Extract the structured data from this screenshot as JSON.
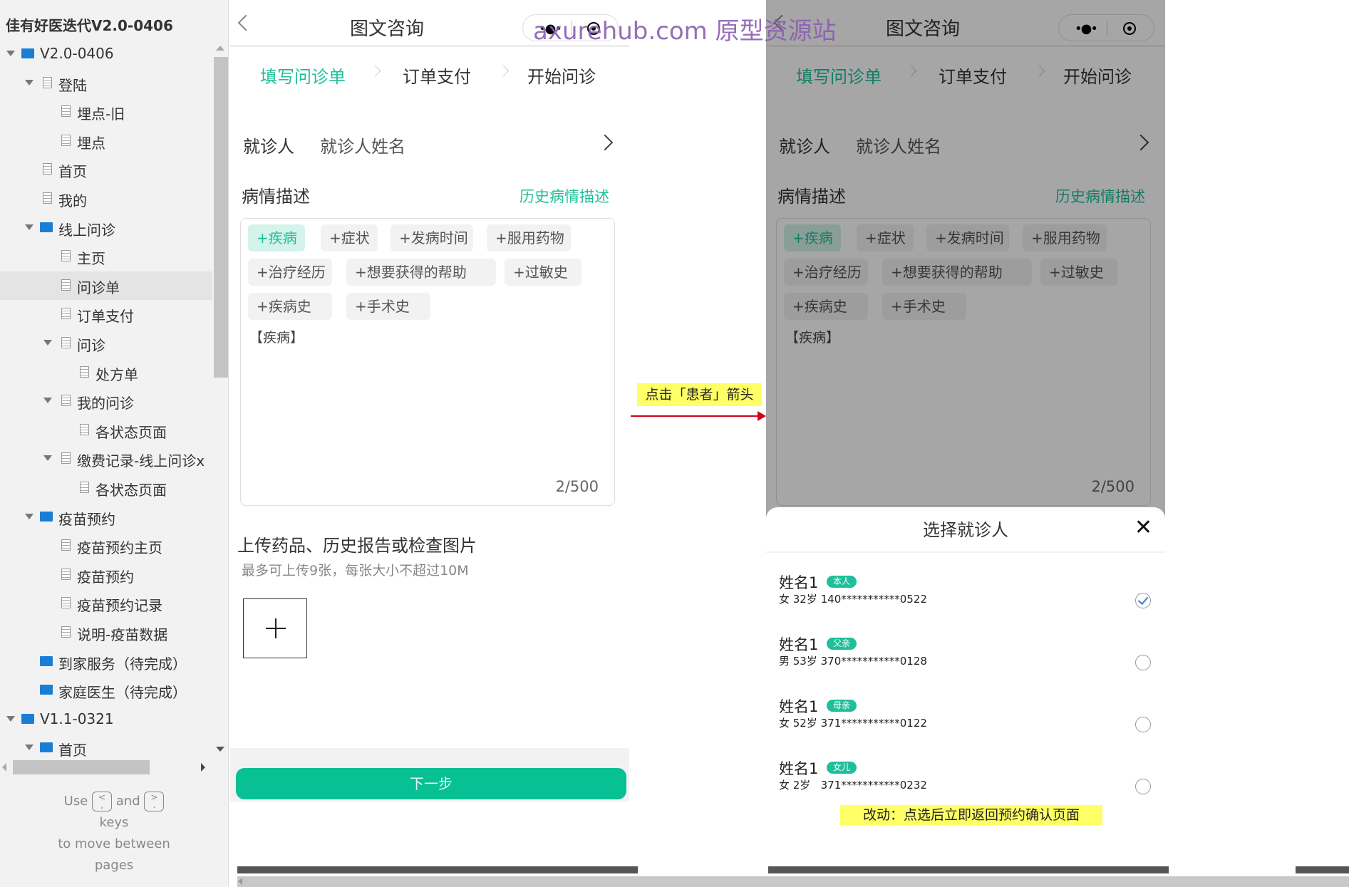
{
  "sidebar": {
    "project_title": "佳有好医迭代V2.0-0406",
    "items": [
      {
        "label": "V2.0-0406",
        "level": 0,
        "type": "folder",
        "expanded": true
      },
      {
        "label": "登陆",
        "level": 1,
        "type": "page",
        "expanded": true
      },
      {
        "label": "埋点-旧",
        "level": 2,
        "type": "page"
      },
      {
        "label": "埋点",
        "level": 2,
        "type": "page"
      },
      {
        "label": "首页",
        "level": 1,
        "type": "page"
      },
      {
        "label": "我的",
        "level": 1,
        "type": "page"
      },
      {
        "label": "线上问诊",
        "level": 1,
        "type": "folder",
        "expanded": true
      },
      {
        "label": "主页",
        "level": 2,
        "type": "page"
      },
      {
        "label": "问诊单",
        "level": 2,
        "type": "page",
        "selected": true
      },
      {
        "label": "订单支付",
        "level": 2,
        "type": "page"
      },
      {
        "label": "问诊",
        "level": 2,
        "type": "page",
        "expanded": true
      },
      {
        "label": "处方单",
        "level": 3,
        "type": "page"
      },
      {
        "label": "我的问诊",
        "level": 2,
        "type": "page",
        "expanded": true
      },
      {
        "label": "各状态页面",
        "level": 3,
        "type": "page"
      },
      {
        "label": "缴费记录-线上问诊x",
        "level": 2,
        "type": "page",
        "expanded": true
      },
      {
        "label": "各状态页面",
        "level": 3,
        "type": "page"
      },
      {
        "label": "疫苗预约",
        "level": 1,
        "type": "folder",
        "expanded": true
      },
      {
        "label": "疫苗预约主页",
        "level": 2,
        "type": "page"
      },
      {
        "label": "疫苗预约",
        "level": 2,
        "type": "page"
      },
      {
        "label": "疫苗预约记录",
        "level": 2,
        "type": "page"
      },
      {
        "label": "说明-疫苗数据",
        "level": 2,
        "type": "page"
      },
      {
        "label": "到家服务（待完成）",
        "level": 1,
        "type": "folder"
      },
      {
        "label": "家庭医生（待完成）",
        "level": 1,
        "type": "folder"
      },
      {
        "label": "V1.1-0321",
        "level": 0,
        "type": "folder",
        "expanded": true
      },
      {
        "label": "首页",
        "level": 1,
        "type": "folder",
        "expanded": true
      }
    ],
    "hint": {
      "use": "Use",
      "key1_top": "<",
      "key1_bottom": ",",
      "and": "and",
      "key2_top": ">",
      "key2_bottom": ".",
      "keys": "keys",
      "line3": "to move between",
      "line4": "pages"
    }
  },
  "phone": {
    "title": "图文咨询",
    "capsule_dots": "•●•",
    "steps": [
      "填写问诊单",
      "订单支付",
      "开始问诊"
    ],
    "active_step": 0,
    "patient_label": "就诊人",
    "patient_value": "就诊人姓名",
    "desc_label": "病情描述",
    "history_link": "历史病情描述",
    "tags": [
      "+疾病",
      "+症状",
      "+发病时间",
      "+服用药物",
      "+治疗经历",
      "+想要获得的帮助",
      "+过敏史",
      "+疾病史",
      "+手术史"
    ],
    "active_tag": 0,
    "desc_text": "【疾病】",
    "counter": "2/500",
    "upload_title": "上传药品、历史报告或检查图片",
    "upload_sub": "最多可上传9张，每张大小不超过10M",
    "next_button": "下一步",
    "accent_color": "#07c094"
  },
  "modal": {
    "title": "选择就诊人",
    "close": "✕",
    "patients": [
      {
        "name": "姓名1",
        "relation": "本人",
        "info": "女 32岁 140***********0522",
        "selected": true
      },
      {
        "name": "姓名1",
        "relation": "父亲",
        "info": "男 53岁 370***********0128",
        "selected": false
      },
      {
        "name": "姓名1",
        "relation": "母亲",
        "info": "女 52岁 371***********0122",
        "selected": false
      },
      {
        "name": "姓名1",
        "relation": "女儿",
        "info": "女 2岁   371***********0232",
        "selected": false
      }
    ]
  },
  "annotations": {
    "arrow_note": "点击「患者」箭头",
    "change_note": "改动：点选后立即返回预约确认页面"
  },
  "watermark": "axurehub.com 原型资源站"
}
